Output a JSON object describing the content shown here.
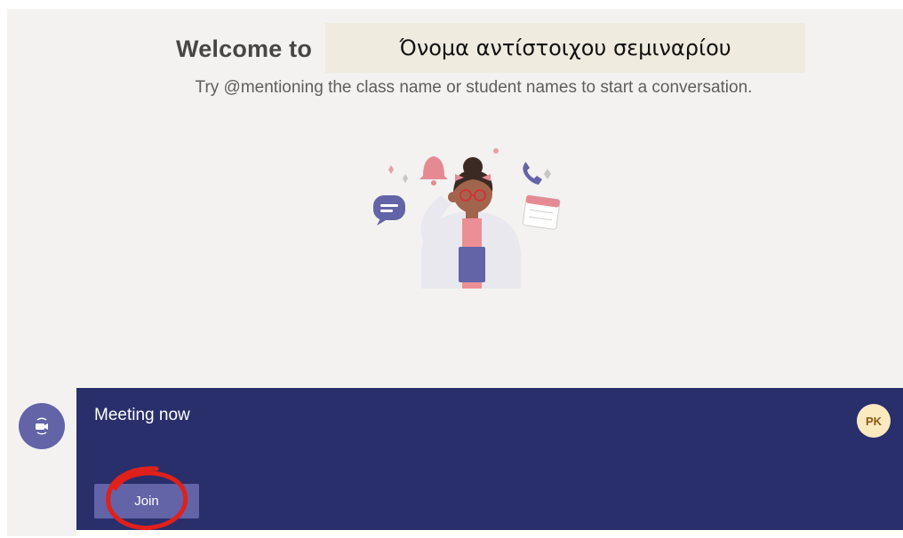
{
  "header": {
    "welcome_text": "Welcome to",
    "class_name": "Όνομα αντίστοιχου σεμιναρίου",
    "hint": "Try @mentioning the class name or student names to start a conversation."
  },
  "meeting": {
    "title": "Meeting now",
    "join_label": "Join",
    "avatar_initials": "PK"
  },
  "icons": {
    "call": "video-call-icon",
    "illustration": "teacher-illustration"
  },
  "colors": {
    "accent": "#6264a7",
    "meeting_card": "#292f6b",
    "background": "#f3f2f1",
    "annotation_circle": "#e0201b"
  }
}
